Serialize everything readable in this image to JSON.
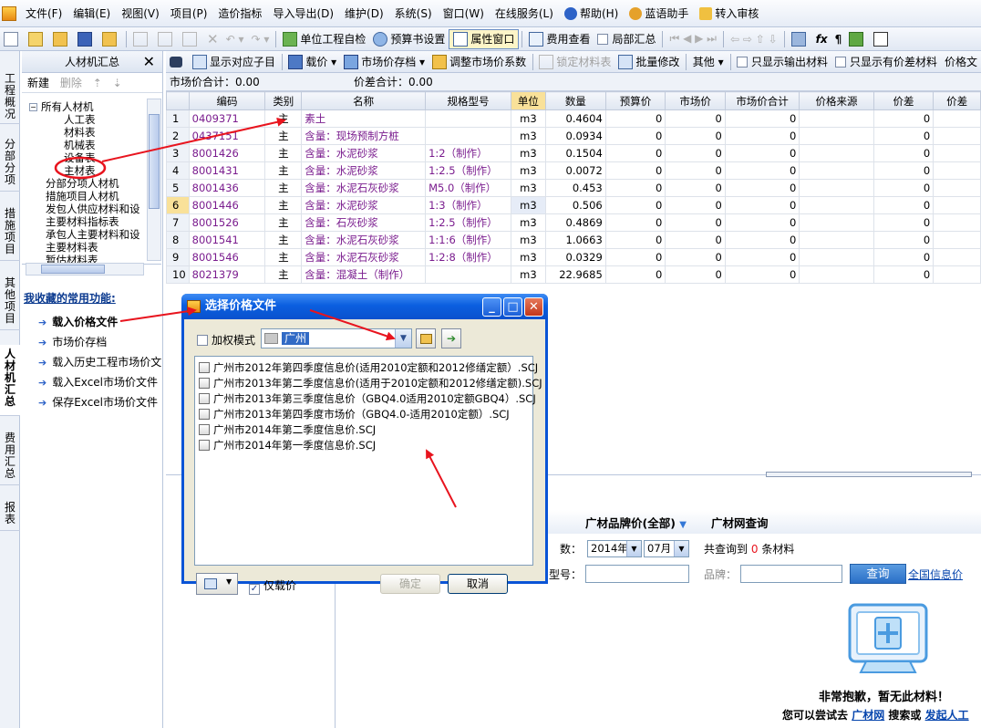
{
  "menu": {
    "items": [
      "文件(F)",
      "编辑(E)",
      "视图(V)",
      "项目(P)",
      "造价指标",
      "导入导出(D)",
      "维护(D)",
      "系统(S)",
      "窗口(W)",
      "在线服务(L)",
      "帮助(H)",
      "蓝语助手",
      "转入审核"
    ]
  },
  "toolbar": {
    "self_check": "单位工程自检",
    "budget_settings": "预算书设置",
    "property_window": "属性窗口",
    "fee_view": "费用查看",
    "partial_summary": "局部汇总"
  },
  "vtabs": [
    "工程概况",
    "分部分项",
    "措施项目",
    "其他项目",
    "人材机汇总",
    "费用汇总",
    "报表"
  ],
  "left_panel": {
    "title": "人材机汇总",
    "tools": {
      "new": "新建",
      "delete": "删除"
    },
    "tree": {
      "root": "所有人材机",
      "children": [
        "人工表",
        "材料表",
        "机械表",
        "设备表",
        "主材表"
      ],
      "others": [
        "分部分项人材机",
        "措施项目人材机",
        "发包人供应材料和设",
        "主要材料指标表",
        "承包人主要材料和设",
        "主要材料表",
        "暂估材料表"
      ]
    },
    "favorites_title": "我收藏的常用功能:",
    "favorites": [
      "载入价格文件",
      "市场价存档",
      "载入历史工程市场价文",
      "载入Excel市场价文件",
      "保存Excel市场价文件"
    ]
  },
  "grid_toolbar": {
    "show_sub": "显示对应子目",
    "load_price": "载价",
    "market_archive": "市场价存档",
    "adjust_coef": "调整市场价系数",
    "lock_table": "锁定材料表",
    "batch_edit": "批量修改",
    "other": "其他",
    "only_output": "只显示输出材料",
    "only_diff": "只显示有价差材料",
    "price_doc": "价格文"
  },
  "summary": {
    "market_total": "市场价合计：0.00",
    "diff_total": "价差合计：0.00"
  },
  "grid": {
    "headers": [
      "编码",
      "类别",
      "名称",
      "规格型号",
      "单位",
      "数量",
      "预算价",
      "市场价",
      "市场价合计",
      "价格来源",
      "价差",
      "价差"
    ],
    "rows": [
      [
        "1",
        "0409371",
        "主",
        "素土",
        "",
        "m3",
        "0.4604",
        "0",
        "0",
        "0",
        "",
        "0"
      ],
      [
        "2",
        "0437151",
        "主",
        "含量：现场预制方桩",
        "",
        "m3",
        "0.0934",
        "0",
        "0",
        "0",
        "",
        "0"
      ],
      [
        "3",
        "8001426",
        "主",
        "含量：水泥砂浆",
        "1:2（制作）",
        "m3",
        "0.1504",
        "0",
        "0",
        "0",
        "",
        "0"
      ],
      [
        "4",
        "8001431",
        "主",
        "含量：水泥砂浆",
        "1:2.5（制作）",
        "m3",
        "0.0072",
        "0",
        "0",
        "0",
        "",
        "0"
      ],
      [
        "5",
        "8001436",
        "主",
        "含量：水泥石灰砂浆",
        "M5.0（制作）",
        "m3",
        "0.453",
        "0",
        "0",
        "0",
        "",
        "0"
      ],
      [
        "6",
        "8001446",
        "主",
        "含量：水泥砂浆",
        "1:3（制作）",
        "m3",
        "0.506",
        "0",
        "0",
        "0",
        "",
        "0"
      ],
      [
        "7",
        "8001526",
        "主",
        "含量：石灰砂浆",
        "1:2.5（制作）",
        "m3",
        "0.4869",
        "0",
        "0",
        "0",
        "",
        "0"
      ],
      [
        "8",
        "8001541",
        "主",
        "含量：水泥石灰砂浆",
        "1:1:6（制作）",
        "m3",
        "1.0663",
        "0",
        "0",
        "0",
        "",
        "0"
      ],
      [
        "9",
        "8001546",
        "主",
        "含量：水泥石灰砂浆",
        "1:2:8（制作）",
        "m3",
        "0.0329",
        "0",
        "0",
        "0",
        "",
        "0"
      ],
      [
        "10",
        "8021379",
        "主",
        "含量：混凝土（制作）",
        "",
        "m3",
        "22.9685",
        "0",
        "0",
        "0",
        "",
        "0"
      ]
    ]
  },
  "lower": {
    "brand_price": "广材品牌价(全部)",
    "brand_query": "广材网查询",
    "count_label": "数：",
    "year": "2014年",
    "month": "07月",
    "found_prefix": "共查询到",
    "found_count": "0",
    "found_suffix": "条材料",
    "model_label": "型号：",
    "brand_label": "品牌：",
    "query_btn": "查询",
    "gov_link": "全国信息价",
    "empty_main": "非常抱歉，暂无此材料！",
    "empty_sub_prefix": "您可以尝试去",
    "empty_sub_link1": "广材网",
    "empty_sub_mid": "搜索或",
    "empty_sub_link2": "发起人工"
  },
  "dialog": {
    "title": "选择价格文件",
    "weight_mode": "加权模式",
    "path": "广州",
    "files": [
      "广州市2012年第四季度信息价(适用2010定额和2012修缮定额）.SCJ",
      "广州市2013年第二季度信息价(适用于2010定额和2012修缮定额).SCJ",
      "广州市2013年第三季度信息价（GBQ4.0适用2010定额GBQ4）.SCJ",
      "广州市2013年第四季度市场价（GBQ4.0-适用2010定额）.SCJ",
      "广州市2014年第二季度信息价.SCJ",
      "广州市2014年第一季度信息价.SCJ"
    ],
    "only_price": "仅载价",
    "ok": "确定",
    "cancel": "取消"
  },
  "colors": {
    "accent_red": "#e8141e",
    "title_blue": "#0a54d6",
    "unit_header": "#f9e199",
    "purple_text": "#7a1c8e"
  }
}
